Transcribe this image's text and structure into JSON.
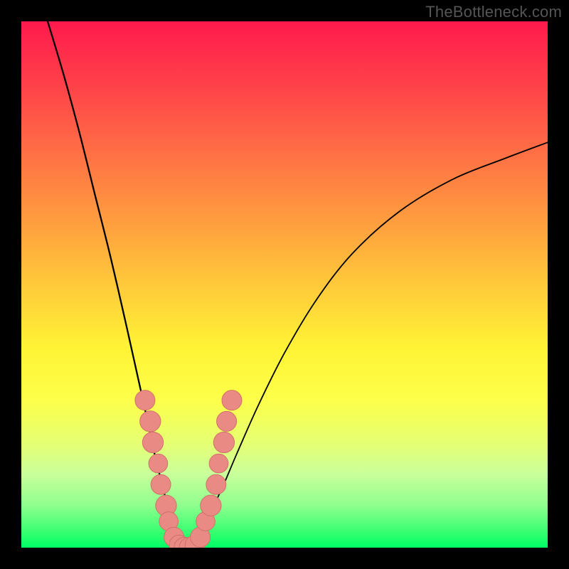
{
  "watermark": "TheBottleneck.com",
  "colors": {
    "curve": "#000000",
    "dot_fill": "#e98b84",
    "dot_stroke": "#d07069"
  },
  "chart_data": {
    "type": "line",
    "title": "",
    "xlabel": "",
    "ylabel": "",
    "xlim": [
      0,
      100
    ],
    "ylim": [
      0,
      100
    ],
    "series": [
      {
        "name": "left-curve",
        "x": [
          5,
          8,
          11,
          14,
          17,
          20,
          22,
          24,
          25.5,
          27,
          28,
          29,
          30,
          31
        ],
        "y": [
          100,
          90,
          79,
          67,
          55,
          42,
          33,
          24,
          17,
          11,
          7,
          4,
          1.5,
          0
        ]
      },
      {
        "name": "right-curve",
        "x": [
          31,
          33,
          35,
          38,
          41,
          45,
          50,
          56,
          63,
          72,
          82,
          92,
          100
        ],
        "y": [
          0,
          1.5,
          5,
          11,
          18,
          27,
          37,
          47,
          56,
          64,
          70,
          74,
          77
        ]
      }
    ],
    "scatter_points": {
      "name": "highlighted-points",
      "points": [
        {
          "x": 23.5,
          "y": 28,
          "r": 1.5
        },
        {
          "x": 24.5,
          "y": 24,
          "r": 1.6
        },
        {
          "x": 25.0,
          "y": 20,
          "r": 1.6
        },
        {
          "x": 26.0,
          "y": 16,
          "r": 1.4
        },
        {
          "x": 26.5,
          "y": 12,
          "r": 1.5
        },
        {
          "x": 27.5,
          "y": 8,
          "r": 1.6
        },
        {
          "x": 28.0,
          "y": 5,
          "r": 1.4
        },
        {
          "x": 29.0,
          "y": 2,
          "r": 1.5
        },
        {
          "x": 30.0,
          "y": 0.5,
          "r": 1.5
        },
        {
          "x": 31.0,
          "y": 0,
          "r": 1.6
        },
        {
          "x": 32.0,
          "y": 0,
          "r": 1.6
        },
        {
          "x": 33.0,
          "y": 0.5,
          "r": 1.5
        },
        {
          "x": 34.0,
          "y": 2,
          "r": 1.5
        },
        {
          "x": 35.0,
          "y": 5,
          "r": 1.4
        },
        {
          "x": 36.0,
          "y": 8,
          "r": 1.6
        },
        {
          "x": 37.0,
          "y": 12,
          "r": 1.5
        },
        {
          "x": 37.5,
          "y": 16,
          "r": 1.4
        },
        {
          "x": 38.5,
          "y": 20,
          "r": 1.6
        },
        {
          "x": 39.0,
          "y": 24,
          "r": 1.5
        },
        {
          "x": 40.0,
          "y": 28,
          "r": 1.5
        }
      ]
    }
  }
}
